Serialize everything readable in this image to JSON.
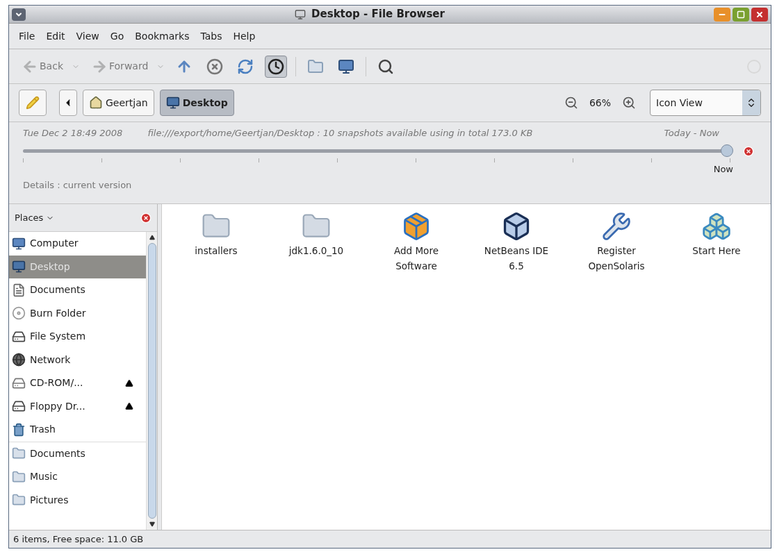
{
  "window": {
    "title": "Desktop - File Browser"
  },
  "menu": [
    "File",
    "Edit",
    "View",
    "Go",
    "Bookmarks",
    "Tabs",
    "Help"
  ],
  "toolbar": [
    {
      "kind": "back",
      "label": "Back",
      "disabled": true,
      "pressed": false
    },
    {
      "kind": "forward",
      "label": "Forward",
      "disabled": true,
      "pressed": false
    },
    {
      "kind": "up",
      "disabled": false,
      "pressed": false
    },
    {
      "kind": "stop",
      "disabled": false,
      "pressed": false
    },
    {
      "kind": "reload",
      "disabled": false,
      "pressed": false
    },
    {
      "kind": "history",
      "disabled": false,
      "pressed": true
    },
    {
      "kind": "separator"
    },
    {
      "kind": "home",
      "disabled": false,
      "pressed": false
    },
    {
      "kind": "computer",
      "disabled": false,
      "pressed": false
    },
    {
      "kind": "separator"
    },
    {
      "kind": "search",
      "disabled": false,
      "pressed": false
    }
  ],
  "location": {
    "path": [
      {
        "label": "Geertjan",
        "kind": "home",
        "selected": false
      },
      {
        "label": "Desktop",
        "kind": "desktop",
        "selected": true
      }
    ],
    "zoom": "66%",
    "view": "Icon View"
  },
  "timeline": {
    "date": "Tue Dec  2 18:49 2008",
    "info": "file:///export/home/Geertjan/Desktop : 10 snapshots available using in total 173.0 KB",
    "range": "Today - Now",
    "level": 1,
    "thumb_label": "Now",
    "details": "Details : current version"
  },
  "sidebar": {
    "title": "Places",
    "groups": [
      [
        {
          "label": "Computer",
          "kind": "computer",
          "selected": false,
          "ejectable": false
        },
        {
          "label": "Desktop",
          "kind": "desktop",
          "selected": true,
          "ejectable": false
        },
        {
          "label": "Documents",
          "kind": "documents",
          "selected": false,
          "ejectable": false
        },
        {
          "label": "Burn Folder",
          "kind": "disc",
          "selected": false,
          "ejectable": false
        },
        {
          "label": "File System",
          "kind": "drive",
          "selected": false,
          "ejectable": false
        },
        {
          "label": "Network",
          "kind": "network",
          "selected": false,
          "ejectable": false
        },
        {
          "label": "CD-ROM/...",
          "kind": "cdrom",
          "selected": false,
          "ejectable": true
        },
        {
          "label": "Floppy Dr...",
          "kind": "drive",
          "selected": false,
          "ejectable": true
        },
        {
          "label": "Trash",
          "kind": "trash",
          "selected": false,
          "ejectable": false
        }
      ],
      [
        {
          "label": "Documents",
          "kind": "folder",
          "selected": false,
          "ejectable": false
        },
        {
          "label": "Music",
          "kind": "folder",
          "selected": false,
          "ejectable": false
        },
        {
          "label": "Pictures",
          "kind": "folder",
          "selected": false,
          "ejectable": false
        }
      ]
    ]
  },
  "files": [
    {
      "name": "installers",
      "kind": "folder"
    },
    {
      "name": "jdk1.6.0_10",
      "kind": "folder"
    },
    {
      "name": "Add More Software",
      "kind": "software"
    },
    {
      "name": "NetBeans IDE 6.5",
      "kind": "cube"
    },
    {
      "name": "Register OpenSolaris",
      "kind": "register"
    },
    {
      "name": "Start Here",
      "kind": "start"
    }
  ],
  "status_bar": "6 items, Free space: 11.0 GB"
}
